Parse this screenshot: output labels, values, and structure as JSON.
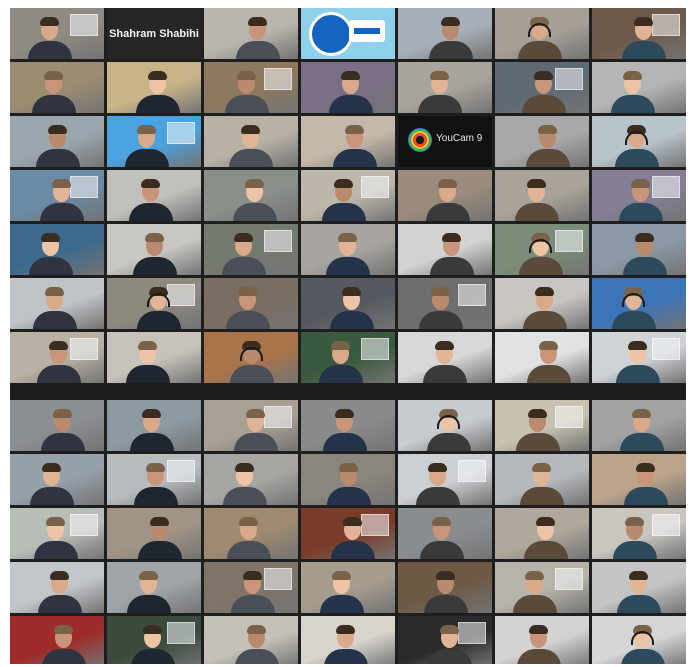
{
  "participant_name": "Shahram Shabihi",
  "camera_app_name": "YouCam 9",
  "tile_colors": [
    "#8e8a84",
    "#262626",
    "#b9b4ad",
    "#8fd0ea",
    "#a7b0b8",
    "#a59f96",
    "#6e5a4a",
    "#9b8c72",
    "#c9b48a",
    "#8e7860",
    "#7a6f86",
    "#a8a49c",
    "#5f6a74",
    "#b5b5b5",
    "#9aa6ae",
    "#4aa3e0",
    "#b8b2a6",
    "#c4b8a8",
    "#111111",
    "#a8a8a8",
    "#b9c3ca",
    "#6b8aa3",
    "#c2c0bb",
    "#8a8f8a",
    "#bdb6aa",
    "#9a8b7c",
    "#a9a39a",
    "#857e95",
    "#3d6a8c",
    "#c9c7c2",
    "#757a70",
    "#a8a5a0",
    "#d2d2d2",
    "#7b8d7a",
    "#8b98a5",
    "#c0c4c8",
    "#8e8a80",
    "#7a6e62",
    "#55595f",
    "#6e6e6e",
    "#c8c5c0",
    "#3c74b8",
    "#b9b2a4",
    "#c7c3bb",
    "#a9744a",
    "#3a5a3f",
    "#d8d8d8",
    "#e1e2e4",
    "#cfd3d6",
    "#8b8e92",
    "#8e9aa2",
    "#a8a095",
    "#8a8a8a",
    "#c8ccd0",
    "#c9c2b2",
    "#a2a2a2",
    "#96a0aa",
    "#b7bcc0",
    "#a8a6a2",
    "#8a867e",
    "#cdd0d3",
    "#b5b9bd",
    "#bca48a",
    "#b9bdb8",
    "#a19486",
    "#9f8a70",
    "#7a3c2a",
    "#8a8d90",
    "#b0a89c",
    "#c9c6c0",
    "#c2c6ca",
    "#9ea4a8",
    "#7e7468",
    "#a59c8e",
    "#6d5a44",
    "#b7b3ab",
    "#c2c4c6",
    "#9f2a2a",
    "#3a4a3c",
    "#c5c1b8",
    "#d8d5cf",
    "#2a2a2a",
    "#d3d3d3",
    "#d4d6d8",
    "#8a7c6a",
    "#b8b3ab",
    "#9a7a5a",
    "#9a9590",
    "#7c8488",
    "#c9c7c3",
    "#c6c8ca",
    "#cfcac2"
  ],
  "headset_tiles": [
    5,
    20,
    33,
    36,
    41,
    44,
    53,
    83,
    89
  ]
}
